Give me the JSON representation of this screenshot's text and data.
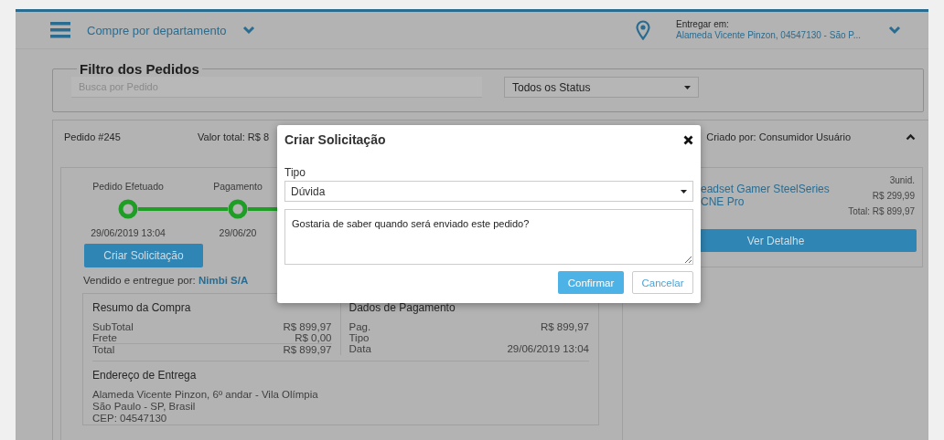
{
  "header": {
    "menu_label": "Compre por departamento",
    "deliver_label": "Entregar em:",
    "deliver_address": "Alameda Vicente Pinzon, 04547130 - São P..."
  },
  "filter": {
    "title": "Filtro dos Pedidos",
    "search_placeholder": "Busca por Pedido",
    "status_value": "Todos os Status"
  },
  "order": {
    "number": "Pedido #245",
    "total": "Valor total: R$ 8",
    "created_by": "Criado por: Consumidor Usuário",
    "expanded": true,
    "steps": [
      {
        "label": "Pedido Efetuado",
        "date": "29/06/2019 13:04",
        "done": true
      },
      {
        "label": "Pagamento",
        "date": "29/06/20",
        "done": true
      }
    ],
    "request_button": "Criar Solicitação",
    "seller_label": "Vendido e entregue por:",
    "seller": "Nimbi S/A",
    "summary": {
      "title": "Resumo da Compra",
      "rows": [
        {
          "label": "SubTotal",
          "value": "R$ 899,97"
        },
        {
          "label": "Frete",
          "value": "R$ 0,00"
        },
        {
          "label": "Total",
          "value": "R$ 899,97"
        }
      ]
    },
    "payment": {
      "title": "Dados de Pagamento",
      "rows": [
        {
          "label": "Pag.",
          "value": "R$ 899,97"
        },
        {
          "label": "Tipo"
        },
        {
          "label": "Data",
          "value": "29/06/2019 13:04"
        }
      ]
    },
    "address": {
      "title": "Endereço de Entrega",
      "lines": [
        "Alameda Vicente Pinzon, 6º andar - Vila Olímpia",
        "São Paulo - SP, Brasil",
        "CEP: 04547130"
      ]
    },
    "product": {
      "name_lines": [
        "eadset Gamer SteelSeries",
        "CNE Pro"
      ],
      "quantity": "3unid.",
      "unit_price": "R$ 299,99",
      "total": "Total: R$ 899,97",
      "detail_button": "Ver Detalhe"
    }
  },
  "modal": {
    "title": "Criar Solicitação",
    "type_label": "Tipo",
    "type_value": "Dúvida",
    "message": "Gostaria de saber quando será enviado este pedido?",
    "confirm": "Confirmar",
    "cancel": "Cancelar"
  }
}
